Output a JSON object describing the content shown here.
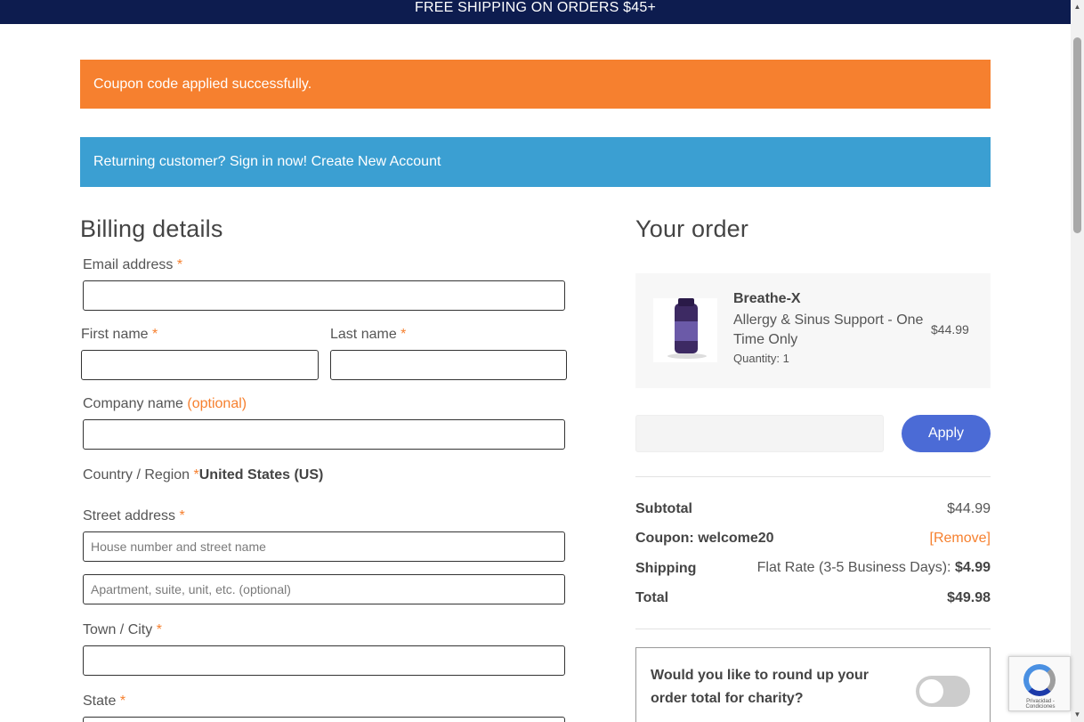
{
  "topbar": {
    "text": "FREE SHIPPING ON ORDERS $45+"
  },
  "notices": {
    "success": "Coupon code applied successfully.",
    "info": "Returning customer? Sign in now! Create New Account"
  },
  "billing": {
    "heading": "Billing details",
    "email_label": "Email address",
    "first_name_label": "First name",
    "last_name_label": "Last name",
    "company_label": "Company name",
    "company_optional": "(optional)",
    "country_label": "Country / Region",
    "country_value": "United States (US)",
    "street_label": "Street address",
    "street_placeholder": "House number and street name",
    "apt_placeholder": "Apartment, suite, unit, etc. (optional)",
    "city_label": "Town / City",
    "state_label": "State",
    "required_mark": "*"
  },
  "order": {
    "heading": "Your order",
    "product": {
      "name": "Breathe-X",
      "variant": "Allergy & Sinus Support - One Time Only",
      "quantity": "Quantity: 1",
      "price": "$44.99"
    },
    "apply_label": "Apply",
    "totals": {
      "subtotal_label": "Subtotal",
      "subtotal_value": "$44.99",
      "coupon_label": "Coupon: welcome20",
      "coupon_remove": "[Remove]",
      "shipping_label": "Shipping",
      "shipping_method": "Flat Rate (3-5 Business Days):",
      "shipping_value": "$4.99",
      "total_label": "Total",
      "total_value": "$49.98"
    },
    "charity_text": "Would you like to round up your order total for charity?",
    "charity_toggle_on": false
  },
  "recaptcha": {
    "text": "Privacidad - Condiciones"
  },
  "colors": {
    "topbar": "#0d1c4f",
    "success": "#f6802f",
    "info": "#3b9fd2",
    "apply": "#4b6bd6"
  }
}
